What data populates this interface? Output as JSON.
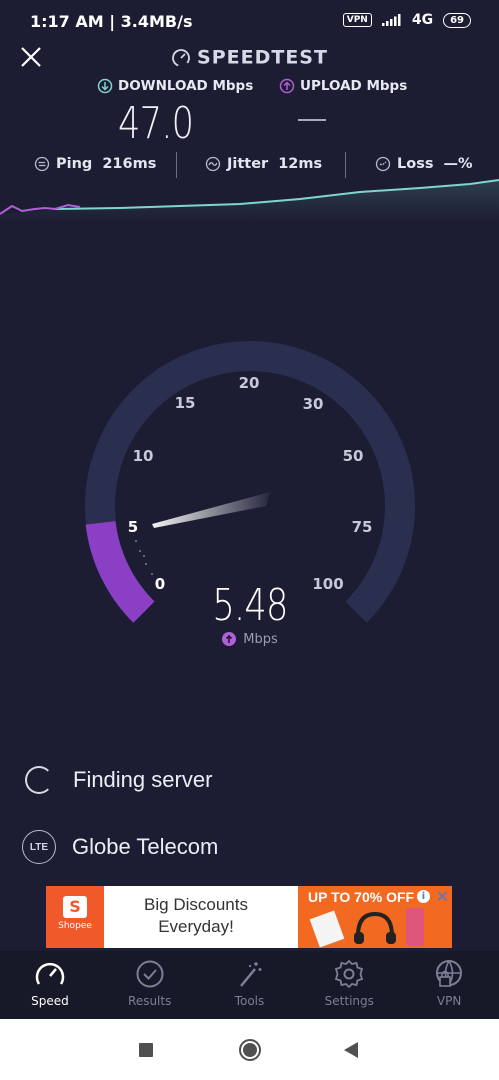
{
  "status_bar": {
    "time": "1:17 AM | 3.4MB/s",
    "vpn": "VPN",
    "network": "4G",
    "battery": "69"
  },
  "header": {
    "title": "SPEEDTEST",
    "download_label": "DOWNLOAD Mbps",
    "download_value": "47.0",
    "upload_label": "UPLOAD Mbps",
    "upload_value": "—"
  },
  "stats": {
    "ping_label": "Ping",
    "ping_value": "216ms",
    "jitter_label": "Jitter",
    "jitter_value": "12ms",
    "loss_label": "Loss",
    "loss_value": "—%"
  },
  "gauge": {
    "ticks": [
      "0",
      "5",
      "10",
      "15",
      "20",
      "30",
      "50",
      "75",
      "100"
    ],
    "value": "5.48",
    "unit": "Mbps",
    "reading_mbps": 5.48
  },
  "server": {
    "status": "Finding server",
    "isp_badge": "LTE",
    "isp": "Globe Telecom"
  },
  "ad": {
    "brand": "Shopee",
    "headline_1": "Big Discounts",
    "headline_2": "Everyday!",
    "promo": "UP TO 70% OFF"
  },
  "nav": [
    {
      "label": "Speed",
      "icon": "speedometer-icon",
      "active": true
    },
    {
      "label": "Results",
      "icon": "check-circle-icon",
      "active": false
    },
    {
      "label": "Tools",
      "icon": "magic-wand-icon",
      "active": false
    },
    {
      "label": "Settings",
      "icon": "gear-icon",
      "active": false
    },
    {
      "label": "VPN",
      "icon": "globe-lock-icon",
      "active": false
    }
  ],
  "colors": {
    "background": "#1c1d33",
    "download_accent": "#7fd6d0",
    "upload_accent": "#b15ed8",
    "gauge_track": "#2b2f4f"
  }
}
